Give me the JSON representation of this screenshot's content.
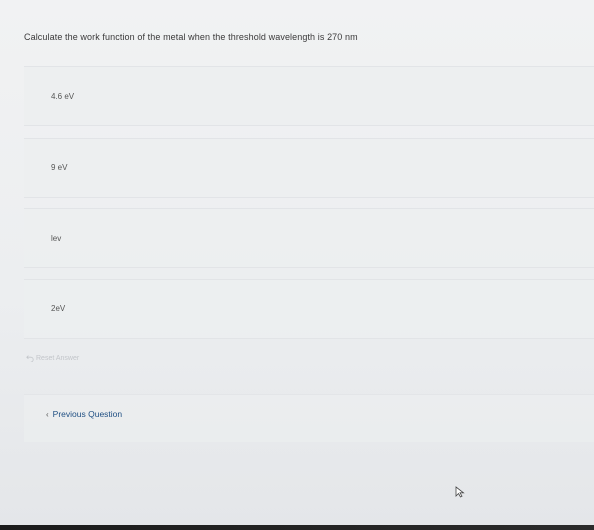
{
  "question": {
    "text": "Calculate the work function of the metal when the threshold wavelength is 270 nm"
  },
  "options": [
    {
      "label": "4.6 eV"
    },
    {
      "label": "9 eV"
    },
    {
      "label": "lev"
    },
    {
      "label": "2eV"
    }
  ],
  "actions": {
    "reset_label": "Reset Answer",
    "previous_label": "Previous Question"
  },
  "icons": {
    "reset": "undo-icon",
    "previous": "chevron-left-icon",
    "cursor": "mouse-cursor-icon"
  },
  "colors": {
    "link": "#1f4f82",
    "reset_text": "#c3c6ca"
  }
}
